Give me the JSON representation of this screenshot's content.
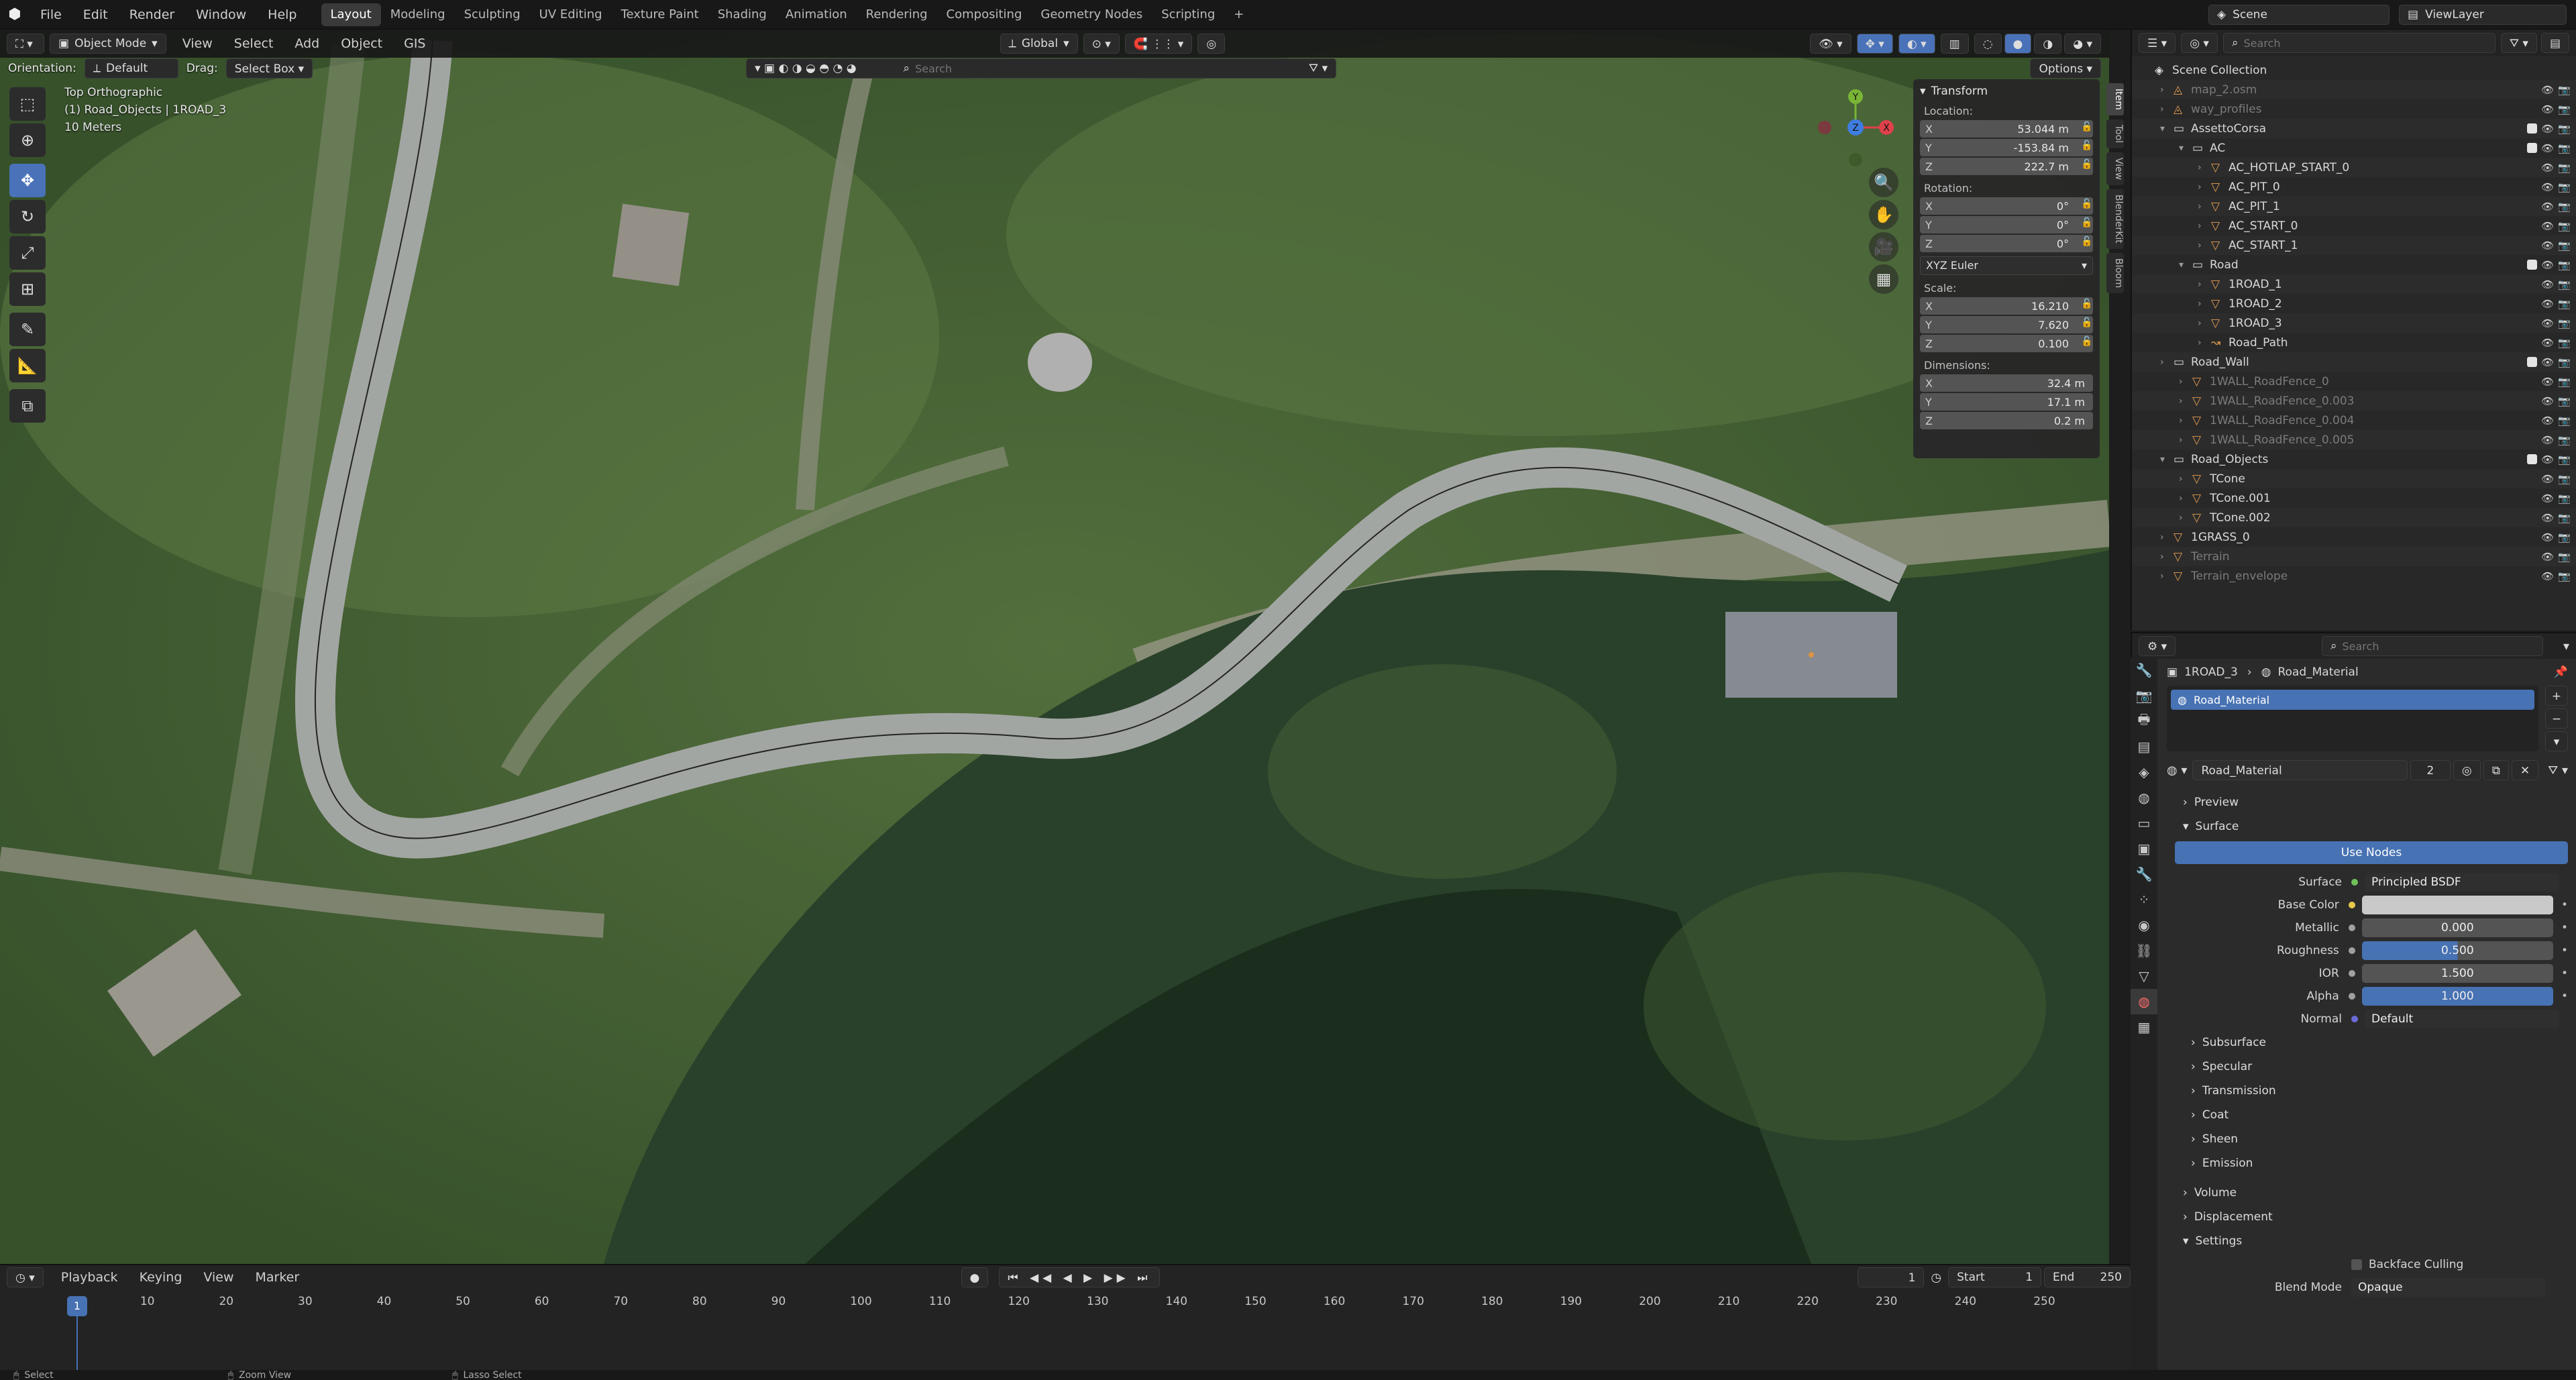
{
  "menubar": {
    "menus": [
      "File",
      "Edit",
      "Render",
      "Window",
      "Help"
    ],
    "workspaces": [
      "Layout",
      "Modeling",
      "Sculpting",
      "UV Editing",
      "Texture Paint",
      "Shading",
      "Animation",
      "Rendering",
      "Compositing",
      "Geometry Nodes",
      "Scripting"
    ],
    "active_workspace": "Layout",
    "scene": "Scene",
    "view_layer": "ViewLayer"
  },
  "viewport_header": {
    "mode": "Object Mode",
    "menus": [
      "View",
      "Select",
      "Add",
      "Object",
      "GIS"
    ],
    "transform_orientation": "Global",
    "orientation_label": "Orientation:",
    "orientation_value": "Default",
    "drag_label": "Drag:",
    "drag_value": "Select Box",
    "search_placeholder": "Search",
    "options_label": "Options"
  },
  "viewport_info": {
    "view_name": "Top Orthographic",
    "active": "(1) Road_Objects | 1ROAD_3",
    "scale": "10 Meters"
  },
  "transform_panel": {
    "title": "Transform",
    "location_label": "Location:",
    "location": {
      "x": "53.044 m",
      "y": "-153.84 m",
      "z": "222.7 m"
    },
    "rotation_label": "Rotation:",
    "rotation": {
      "x": "0°",
      "y": "0°",
      "z": "0°"
    },
    "rotation_mode": "XYZ Euler",
    "scale_label": "Scale:",
    "scale": {
      "x": "16.210",
      "y": "7.620",
      "z": "0.100"
    },
    "dimensions_label": "Dimensions:",
    "dimensions": {
      "x": "32.4 m",
      "y": "17.1 m",
      "z": "0.2 m"
    }
  },
  "side_tabs": [
    "Item",
    "Tool",
    "View",
    "BlenderKit",
    "Bloom"
  ],
  "gizmo": {
    "x": "X",
    "y": "Y",
    "z": "Z"
  },
  "outliner": {
    "search_placeholder": "Search",
    "rows": [
      {
        "label": "Scene Collection",
        "indent": 0,
        "type": "scene",
        "dim": false
      },
      {
        "label": "map_2.osm",
        "indent": 1,
        "type": "object",
        "dim": true
      },
      {
        "label": "way_profiles",
        "indent": 1,
        "type": "object",
        "dim": true
      },
      {
        "label": "AssettoCorsa",
        "indent": 1,
        "type": "collection",
        "dim": false
      },
      {
        "label": "AC",
        "indent": 2,
        "type": "collection",
        "dim": false
      },
      {
        "label": "AC_HOTLAP_START_0",
        "indent": 3,
        "type": "mesh",
        "dim": false
      },
      {
        "label": "AC_PIT_0",
        "indent": 3,
        "type": "mesh",
        "dim": false
      },
      {
        "label": "AC_PIT_1",
        "indent": 3,
        "type": "mesh",
        "dim": false
      },
      {
        "label": "AC_START_0",
        "indent": 3,
        "type": "mesh",
        "dim": false
      },
      {
        "label": "AC_START_1",
        "indent": 3,
        "type": "mesh",
        "dim": false
      },
      {
        "label": "Road",
        "indent": 2,
        "type": "collection",
        "dim": false
      },
      {
        "label": "1ROAD_1",
        "indent": 3,
        "type": "mesh",
        "dim": false
      },
      {
        "label": "1ROAD_2",
        "indent": 3,
        "type": "mesh",
        "dim": false
      },
      {
        "label": "1ROAD_3",
        "indent": 3,
        "type": "mesh",
        "dim": false
      },
      {
        "label": "Road_Path",
        "indent": 3,
        "type": "curve",
        "dim": false
      },
      {
        "label": "Road_Wall",
        "indent": 1,
        "type": "collection",
        "dim": false
      },
      {
        "label": "1WALL_RoadFence_0",
        "indent": 2,
        "type": "mesh",
        "dim": true
      },
      {
        "label": "1WALL_RoadFence_0.003",
        "indent": 2,
        "type": "mesh",
        "dim": true
      },
      {
        "label": "1WALL_RoadFence_0.004",
        "indent": 2,
        "type": "mesh",
        "dim": true
      },
      {
        "label": "1WALL_RoadFence_0.005",
        "indent": 2,
        "type": "mesh",
        "dim": true
      },
      {
        "label": "Road_Objects",
        "indent": 1,
        "type": "collection",
        "dim": false
      },
      {
        "label": "TCone",
        "indent": 2,
        "type": "mesh",
        "dim": false
      },
      {
        "label": "TCone.001",
        "indent": 2,
        "type": "mesh",
        "dim": false
      },
      {
        "label": "TCone.002",
        "indent": 2,
        "type": "mesh",
        "dim": false
      },
      {
        "label": "1GRASS_0",
        "indent": 1,
        "type": "mesh",
        "dim": false
      },
      {
        "label": "Terrain",
        "indent": 1,
        "type": "mesh",
        "dim": true
      },
      {
        "label": "Terrain_envelope",
        "indent": 1,
        "type": "mesh",
        "dim": true
      }
    ]
  },
  "properties": {
    "search_placeholder": "Search",
    "breadcrumb_object": "1ROAD_3",
    "breadcrumb_material": "Road_Material",
    "slot_name": "Road_Material",
    "material_name": "Road_Material",
    "user_count": "2",
    "preview_label": "Preview",
    "surface_label": "Surface",
    "use_nodes": "Use Nodes",
    "fields": [
      {
        "label": "Surface",
        "value": "Principled BSDF",
        "kind": "node",
        "fill": 0
      },
      {
        "label": "Base Color",
        "value": "",
        "kind": "color",
        "fill": 0
      },
      {
        "label": "Metallic",
        "value": "0.000",
        "kind": "slider",
        "fill": 0
      },
      {
        "label": "Roughness",
        "value": "0.500",
        "kind": "slider",
        "fill": 50
      },
      {
        "label": "IOR",
        "value": "1.500",
        "kind": "slider",
        "fill": 0
      },
      {
        "label": "Alpha",
        "value": "1.000",
        "kind": "slider",
        "fill": 100
      },
      {
        "label": "Normal",
        "value": "Default",
        "kind": "node",
        "fill": 0
      }
    ],
    "subsections": [
      "Subsurface",
      "Specular",
      "Transmission",
      "Coat",
      "Sheen",
      "Emission"
    ],
    "volume_label": "Volume",
    "displacement_label": "Displacement",
    "settings_label": "Settings",
    "backface_culling": "Backface Culling",
    "blend_mode_label": "Blend Mode",
    "blend_mode": "Opaque"
  },
  "timeline": {
    "menus": [
      "Playback",
      "Keying",
      "View",
      "Marker"
    ],
    "current_frame": "1",
    "start_label": "Start",
    "start": "1",
    "end_label": "End",
    "end": "250",
    "ruler": [
      "1",
      "10",
      "20",
      "30",
      "40",
      "50",
      "60",
      "70",
      "80",
      "90",
      "100",
      "110",
      "120",
      "130",
      "140",
      "150",
      "160",
      "170",
      "180",
      "190",
      "200",
      "210",
      "220",
      "230",
      "240",
      "250"
    ]
  },
  "statusbar": {
    "items": [
      "Select",
      "Zoom View",
      "Lasso Select"
    ]
  }
}
